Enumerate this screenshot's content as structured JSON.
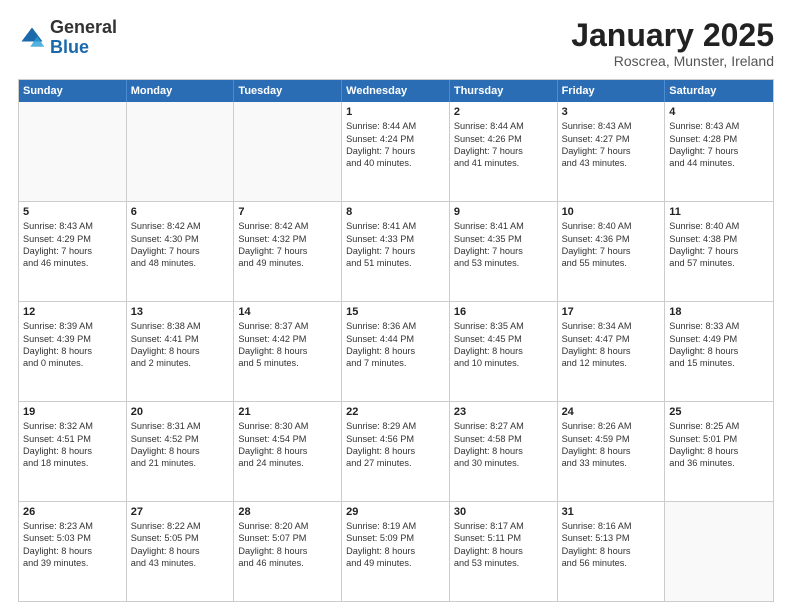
{
  "header": {
    "logo_general": "General",
    "logo_blue": "Blue",
    "month_title": "January 2025",
    "location": "Roscrea, Munster, Ireland"
  },
  "weekdays": [
    "Sunday",
    "Monday",
    "Tuesday",
    "Wednesday",
    "Thursday",
    "Friday",
    "Saturday"
  ],
  "rows": [
    [
      {
        "day": "",
        "lines": []
      },
      {
        "day": "",
        "lines": []
      },
      {
        "day": "",
        "lines": []
      },
      {
        "day": "1",
        "lines": [
          "Sunrise: 8:44 AM",
          "Sunset: 4:24 PM",
          "Daylight: 7 hours",
          "and 40 minutes."
        ]
      },
      {
        "day": "2",
        "lines": [
          "Sunrise: 8:44 AM",
          "Sunset: 4:26 PM",
          "Daylight: 7 hours",
          "and 41 minutes."
        ]
      },
      {
        "day": "3",
        "lines": [
          "Sunrise: 8:43 AM",
          "Sunset: 4:27 PM",
          "Daylight: 7 hours",
          "and 43 minutes."
        ]
      },
      {
        "day": "4",
        "lines": [
          "Sunrise: 8:43 AM",
          "Sunset: 4:28 PM",
          "Daylight: 7 hours",
          "and 44 minutes."
        ]
      }
    ],
    [
      {
        "day": "5",
        "lines": [
          "Sunrise: 8:43 AM",
          "Sunset: 4:29 PM",
          "Daylight: 7 hours",
          "and 46 minutes."
        ]
      },
      {
        "day": "6",
        "lines": [
          "Sunrise: 8:42 AM",
          "Sunset: 4:30 PM",
          "Daylight: 7 hours",
          "and 48 minutes."
        ]
      },
      {
        "day": "7",
        "lines": [
          "Sunrise: 8:42 AM",
          "Sunset: 4:32 PM",
          "Daylight: 7 hours",
          "and 49 minutes."
        ]
      },
      {
        "day": "8",
        "lines": [
          "Sunrise: 8:41 AM",
          "Sunset: 4:33 PM",
          "Daylight: 7 hours",
          "and 51 minutes."
        ]
      },
      {
        "day": "9",
        "lines": [
          "Sunrise: 8:41 AM",
          "Sunset: 4:35 PM",
          "Daylight: 7 hours",
          "and 53 minutes."
        ]
      },
      {
        "day": "10",
        "lines": [
          "Sunrise: 8:40 AM",
          "Sunset: 4:36 PM",
          "Daylight: 7 hours",
          "and 55 minutes."
        ]
      },
      {
        "day": "11",
        "lines": [
          "Sunrise: 8:40 AM",
          "Sunset: 4:38 PM",
          "Daylight: 7 hours",
          "and 57 minutes."
        ]
      }
    ],
    [
      {
        "day": "12",
        "lines": [
          "Sunrise: 8:39 AM",
          "Sunset: 4:39 PM",
          "Daylight: 8 hours",
          "and 0 minutes."
        ]
      },
      {
        "day": "13",
        "lines": [
          "Sunrise: 8:38 AM",
          "Sunset: 4:41 PM",
          "Daylight: 8 hours",
          "and 2 minutes."
        ]
      },
      {
        "day": "14",
        "lines": [
          "Sunrise: 8:37 AM",
          "Sunset: 4:42 PM",
          "Daylight: 8 hours",
          "and 5 minutes."
        ]
      },
      {
        "day": "15",
        "lines": [
          "Sunrise: 8:36 AM",
          "Sunset: 4:44 PM",
          "Daylight: 8 hours",
          "and 7 minutes."
        ]
      },
      {
        "day": "16",
        "lines": [
          "Sunrise: 8:35 AM",
          "Sunset: 4:45 PM",
          "Daylight: 8 hours",
          "and 10 minutes."
        ]
      },
      {
        "day": "17",
        "lines": [
          "Sunrise: 8:34 AM",
          "Sunset: 4:47 PM",
          "Daylight: 8 hours",
          "and 12 minutes."
        ]
      },
      {
        "day": "18",
        "lines": [
          "Sunrise: 8:33 AM",
          "Sunset: 4:49 PM",
          "Daylight: 8 hours",
          "and 15 minutes."
        ]
      }
    ],
    [
      {
        "day": "19",
        "lines": [
          "Sunrise: 8:32 AM",
          "Sunset: 4:51 PM",
          "Daylight: 8 hours",
          "and 18 minutes."
        ]
      },
      {
        "day": "20",
        "lines": [
          "Sunrise: 8:31 AM",
          "Sunset: 4:52 PM",
          "Daylight: 8 hours",
          "and 21 minutes."
        ]
      },
      {
        "day": "21",
        "lines": [
          "Sunrise: 8:30 AM",
          "Sunset: 4:54 PM",
          "Daylight: 8 hours",
          "and 24 minutes."
        ]
      },
      {
        "day": "22",
        "lines": [
          "Sunrise: 8:29 AM",
          "Sunset: 4:56 PM",
          "Daylight: 8 hours",
          "and 27 minutes."
        ]
      },
      {
        "day": "23",
        "lines": [
          "Sunrise: 8:27 AM",
          "Sunset: 4:58 PM",
          "Daylight: 8 hours",
          "and 30 minutes."
        ]
      },
      {
        "day": "24",
        "lines": [
          "Sunrise: 8:26 AM",
          "Sunset: 4:59 PM",
          "Daylight: 8 hours",
          "and 33 minutes."
        ]
      },
      {
        "day": "25",
        "lines": [
          "Sunrise: 8:25 AM",
          "Sunset: 5:01 PM",
          "Daylight: 8 hours",
          "and 36 minutes."
        ]
      }
    ],
    [
      {
        "day": "26",
        "lines": [
          "Sunrise: 8:23 AM",
          "Sunset: 5:03 PM",
          "Daylight: 8 hours",
          "and 39 minutes."
        ]
      },
      {
        "day": "27",
        "lines": [
          "Sunrise: 8:22 AM",
          "Sunset: 5:05 PM",
          "Daylight: 8 hours",
          "and 43 minutes."
        ]
      },
      {
        "day": "28",
        "lines": [
          "Sunrise: 8:20 AM",
          "Sunset: 5:07 PM",
          "Daylight: 8 hours",
          "and 46 minutes."
        ]
      },
      {
        "day": "29",
        "lines": [
          "Sunrise: 8:19 AM",
          "Sunset: 5:09 PM",
          "Daylight: 8 hours",
          "and 49 minutes."
        ]
      },
      {
        "day": "30",
        "lines": [
          "Sunrise: 8:17 AM",
          "Sunset: 5:11 PM",
          "Daylight: 8 hours",
          "and 53 minutes."
        ]
      },
      {
        "day": "31",
        "lines": [
          "Sunrise: 8:16 AM",
          "Sunset: 5:13 PM",
          "Daylight: 8 hours",
          "and 56 minutes."
        ]
      },
      {
        "day": "",
        "lines": []
      }
    ]
  ]
}
